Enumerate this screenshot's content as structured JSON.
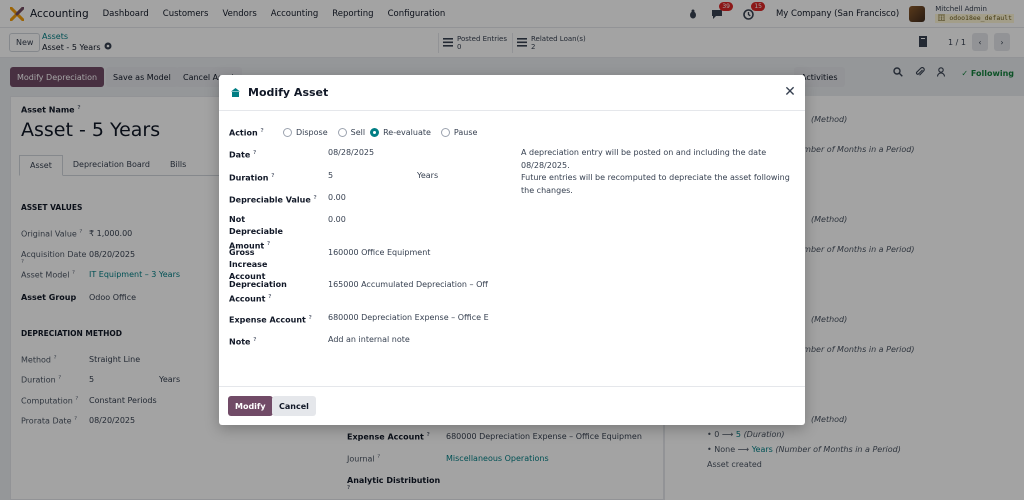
{
  "navbar": {
    "app_name": "Accounting",
    "menu": [
      "Dashboard",
      "Customers",
      "Vendors",
      "Accounting",
      "Reporting",
      "Configuration"
    ],
    "messages_badge": "39",
    "activities_badge": "15",
    "company": "My Company (San Francisco)",
    "user_name": "Mitchell Admin",
    "user_db": "odoo18ee_default"
  },
  "control": {
    "new_label": "New",
    "breadcrumb_parent": "Assets",
    "breadcrumb_current": "Asset - 5 Years",
    "posted_entries_label": "Posted Entries",
    "posted_entries_count": "0",
    "related_loans_label": "Related Loan(s)",
    "related_loans_count": "2",
    "pager": "1 / 1"
  },
  "actions": {
    "modify_depreciation": "Modify Depreciation",
    "save_as_model": "Save as Model",
    "cancel_asset": "Cancel Asset",
    "activities": "Activities",
    "following": "Following"
  },
  "form": {
    "asset_label": "Asset Name",
    "asset_title": "Asset - 5 Years",
    "tabs": [
      "Asset",
      "Depreciation Board",
      "Bills"
    ],
    "values_heading": "ASSET VALUES",
    "original_value_label": "Original Value",
    "original_value": "₹ 1,000.00",
    "acquisition_date_label": "Acquisition Date",
    "acquisition_date": "08/20/2025",
    "asset_model_label": "Asset Model",
    "asset_model": "IT Equipment – 3 Years",
    "asset_group_label": "Asset Group",
    "asset_group": "Odoo Office",
    "method_heading": "DEPRECIATION METHOD",
    "method_label": "Method",
    "method": "Straight Line",
    "duration_label": "Duration",
    "duration_value": "5",
    "duration_unit": "Years",
    "computation_label": "Computation",
    "computation": "Constant Periods",
    "prorata_label": "Prorata Date",
    "prorata_date": "08/20/2025",
    "expense_account_label": "Expense Account",
    "expense_account": "680000 Depreciation Expense – Office Equipmen",
    "journal_label": "Journal",
    "journal": "Miscellaneous Operations",
    "analytic_label": "Analytic Distribution"
  },
  "chatter": {
    "method": "(Method)",
    "months": "(Number of Months in a Period)",
    "duration_line_old": "0",
    "duration_line_new": "5",
    "duration_line_field": "(Duration)",
    "none_line_old": "None",
    "none_line_new": "Years",
    "none_line_field": "(Number of Months in a Period)",
    "asset_created": "Asset created"
  },
  "modal": {
    "title": "Modify Asset",
    "action_label": "Action",
    "actions": [
      {
        "label": "Dispose",
        "checked": false
      },
      {
        "label": "Sell",
        "checked": false
      },
      {
        "label": "Re-evaluate",
        "checked": true
      },
      {
        "label": "Pause",
        "checked": false
      }
    ],
    "date_label": "Date",
    "date": "08/28/2025",
    "duration_label": "Duration",
    "duration_value": "5",
    "duration_unit": "Years",
    "depreciable_label": "Depreciable Value",
    "depreciable_value": "0.00",
    "not_depreciable_label": "Not Depreciable Amount",
    "not_depreciable_value": "0.00",
    "gross_increase_label": "Gross Increase Account",
    "gross_increase_value": "160000 Office Equipment",
    "depreciation_account_label": "Depreciation Account",
    "depreciation_account_value": "165000 Accumulated Depreciation – Off",
    "expense_account_label": "Expense Account",
    "expense_account_value": "680000 Depreciation Expense – Office E",
    "note_label": "Note",
    "note_placeholder": "Add an internal note",
    "info_line1": "A depreciation entry will be posted on and including the date 08/28/2025.",
    "info_line2": "Future entries will be recomputed to depreciate the asset following the changes.",
    "modify_label": "Modify",
    "cancel_label": "Cancel"
  },
  "colors": {
    "primary": "#714b67",
    "link": "#017e84",
    "badge": "#dc2626"
  }
}
